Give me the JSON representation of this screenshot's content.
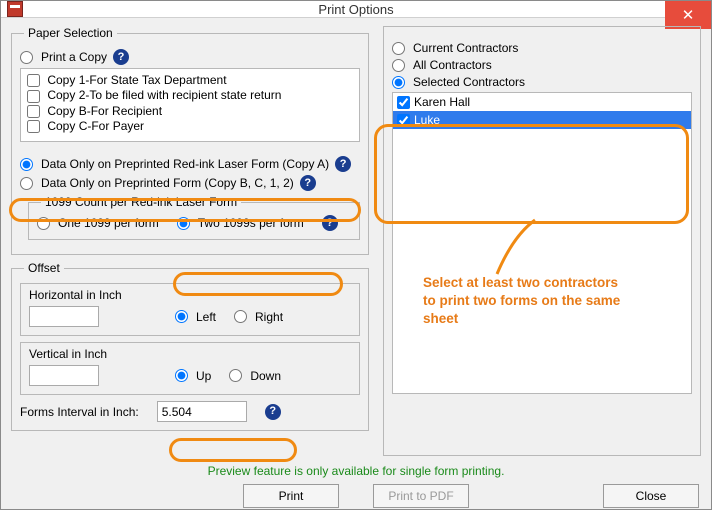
{
  "window": {
    "title": "Print Options"
  },
  "paper": {
    "legend": "Paper Selection",
    "printCopy": {
      "label": "Print a Copy"
    },
    "copies": [
      {
        "label": "Copy 1-For State Tax Department"
      },
      {
        "label": "Copy 2-To be filed with recipient state return"
      },
      {
        "label": "Copy B-For Recipient"
      },
      {
        "label": "Copy C-For Payer"
      }
    ],
    "redInk": {
      "label": "Data Only on Preprinted Red-ink Laser Form (Copy A)"
    },
    "plain": {
      "label": "Data Only on Preprinted  Form (Copy B, C, 1, 2)"
    }
  },
  "count": {
    "legend": "1099 Count per Red-ink Laser Form",
    "one": "One 1099 per form",
    "two": "Two 1099s per form"
  },
  "offset": {
    "legend": "Offset",
    "hLabel": "Horizontal in Inch",
    "hValue": "",
    "left": "Left",
    "right": "Right",
    "vLabel": "Vertical in Inch",
    "vValue": "",
    "up": "Up",
    "down": "Down",
    "intervalLabel": "Forms Interval in Inch:",
    "intervalValue": "5.504"
  },
  "contractors": {
    "current": "Current Contractors",
    "all": "All Contractors",
    "selected": "Selected Contractors",
    "items": [
      {
        "name": "Karen Hall",
        "checked": true,
        "highlighted": false
      },
      {
        "name": "Luke",
        "checked": true,
        "highlighted": true
      }
    ]
  },
  "note": {
    "l1": "Select at least two contractors",
    "l2": "to print two forms on the same",
    "l3": "sheet"
  },
  "footer": {
    "preview": "Preview feature is only available for single form printing.",
    "print": "Print",
    "pdf": "Print to PDF",
    "close": "Close"
  }
}
